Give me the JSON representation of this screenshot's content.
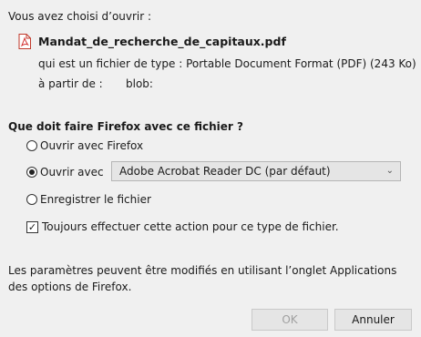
{
  "dialog": {
    "intro": "Vous avez choisi d’ouvrir :",
    "file_name": "Mandat_de_recherche_de_capitaux.pdf",
    "file_type": "qui est un fichier de type : Portable Document Format (PDF) (243 Ko)",
    "from_label": "à partir de :",
    "from_value": "blob:",
    "question": "Que doit faire Firefox avec ce fichier ?",
    "options": {
      "open_firefox": "Ouvrir avec Firefox",
      "open_with": "Ouvrir avec",
      "save_file": "Enregistrer le fichier"
    },
    "selected_option": "open_with",
    "app_select_value": "Adobe Acrobat Reader DC (par défaut)",
    "always_checkbox": "Toujours effectuer cette action pour ce type de fichier.",
    "always_checked": true,
    "note": "Les paramètres peuvent être modifiés en utilisant l’onglet Applications des options de Firefox.",
    "buttons": {
      "ok": "OK",
      "cancel": "Annuler"
    }
  },
  "icons": {
    "file_icon": "pdf-file-icon",
    "dropdown": "chevron-down-icon",
    "check": "checkmark-icon"
  }
}
